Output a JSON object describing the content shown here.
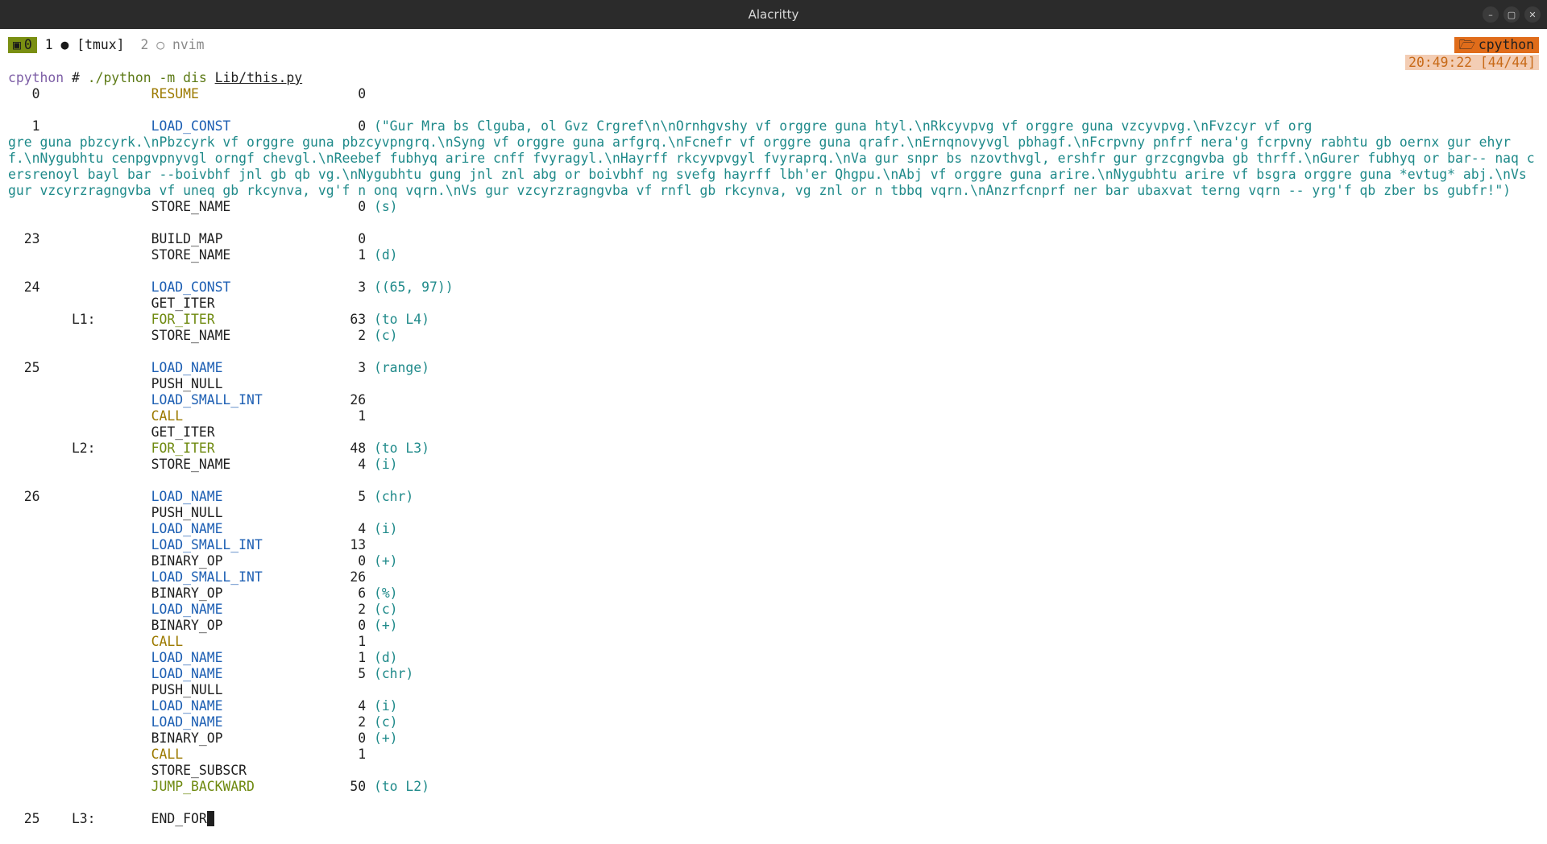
{
  "window": {
    "title": "Alacritty"
  },
  "tmux": {
    "session": "0",
    "windows": [
      {
        "index": "1",
        "flag": "●",
        "name": "[tmux]",
        "active": true
      },
      {
        "index": "2",
        "flag": "○",
        "name": "nvim",
        "active": false
      }
    ],
    "right_label": "cpython",
    "clock": "20:49:22 [44/44]"
  },
  "prompt": {
    "host": "cpython",
    "symbol": "#",
    "cmd": "./python -m dis ",
    "file": "Lib/this.py"
  },
  "disasm": {
    "rows": [
      {
        "ln": "0",
        "label": "",
        "op": "RESUME",
        "oc": "op-yellow",
        "arg": "0",
        "extra": ""
      },
      {
        "blank": true
      },
      {
        "ln": "1",
        "label": "",
        "op": "LOAD_CONST",
        "oc": "op-blue",
        "arg": "0",
        "extra": "(\"Gur Mra bs Clguba, ol Gvz Crgref\\n\\nOrnhgvshy vf orggre guna htyl.\\nRkcyvpvg vf orggre guna vzcyvpvg.\\nFvzcyr vf orggre guna pbzcyrk.\\nPbzcyrk vf orggre guna pbzcyvpngrq.\\nSyng vf orggre guna arfgrq.\\nFcnefr vf orggre guna qrafr.\\nErnqnovyvgl pbhagf.\\nFcrpvny pnfrf nera'g fcrpvny rabhtu gb oernx gur ehyrf.\\nNygubhtu cenpgvpnyvgl orngf chevgl.\\nReebef fubhyq arire cnff fvyragyl.\\nHayrff rkcyvpvgyl fvyraprq.\\nVa gur snpr bs nzovthvgl, ershfr gur grzcgngvba gb thrff.\\nGurer fubhyq or bar-- naq cersrenoyl bayl bar --boivbhf jnl gb qb vg.\\nNygubhtu gung jnl znl abg or boivbhf ng svefg hayrff lbh'er Qhgpu.\\nAbj vf orggre guna arire.\\nNygubhtu arire vf bsgra orggre guna *evtug* abj.\\nVs gur vzcyrzragngvba vf uneq gb rkcynva, vg'f n onq vqrn.\\nVs gur vzcyrzragngvba vf rnfl gb rkcynva, vg znl or n tbbq vqrn.\\nAnzrfcnprf ner bar ubaxvat terng vqrn -- yrg'f qb zber bs gubfr!\")",
        "wrap": true
      },
      {
        "ln": "",
        "label": "",
        "op": "STORE_NAME",
        "oc": "op-plain",
        "arg": "0",
        "extra": "(s)"
      },
      {
        "blank": true
      },
      {
        "ln": "23",
        "label": "",
        "op": "BUILD_MAP",
        "oc": "op-plain",
        "arg": "0",
        "extra": ""
      },
      {
        "ln": "",
        "label": "",
        "op": "STORE_NAME",
        "oc": "op-plain",
        "arg": "1",
        "extra": "(d)"
      },
      {
        "blank": true
      },
      {
        "ln": "24",
        "label": "",
        "op": "LOAD_CONST",
        "oc": "op-blue",
        "arg": "3",
        "extra": "((65, 97))"
      },
      {
        "ln": "",
        "label": "",
        "op": "GET_ITER",
        "oc": "op-plain",
        "arg": "",
        "extra": ""
      },
      {
        "ln": "",
        "label": "L1:",
        "op": "FOR_ITER",
        "oc": "op-green",
        "arg": "63",
        "extra": "(to L4)"
      },
      {
        "ln": "",
        "label": "",
        "op": "STORE_NAME",
        "oc": "op-plain",
        "arg": "2",
        "extra": "(c)"
      },
      {
        "blank": true
      },
      {
        "ln": "25",
        "label": "",
        "op": "LOAD_NAME",
        "oc": "op-blue",
        "arg": "3",
        "extra": "(range)"
      },
      {
        "ln": "",
        "label": "",
        "op": "PUSH_NULL",
        "oc": "op-plain",
        "arg": "",
        "extra": ""
      },
      {
        "ln": "",
        "label": "",
        "op": "LOAD_SMALL_INT",
        "oc": "op-blue",
        "arg": "26",
        "extra": ""
      },
      {
        "ln": "",
        "label": "",
        "op": "CALL",
        "oc": "op-yellow",
        "arg": "1",
        "extra": ""
      },
      {
        "ln": "",
        "label": "",
        "op": "GET_ITER",
        "oc": "op-plain",
        "arg": "",
        "extra": ""
      },
      {
        "ln": "",
        "label": "L2:",
        "op": "FOR_ITER",
        "oc": "op-green",
        "arg": "48",
        "extra": "(to L3)"
      },
      {
        "ln": "",
        "label": "",
        "op": "STORE_NAME",
        "oc": "op-plain",
        "arg": "4",
        "extra": "(i)"
      },
      {
        "blank": true
      },
      {
        "ln": "26",
        "label": "",
        "op": "LOAD_NAME",
        "oc": "op-blue",
        "arg": "5",
        "extra": "(chr)"
      },
      {
        "ln": "",
        "label": "",
        "op": "PUSH_NULL",
        "oc": "op-plain",
        "arg": "",
        "extra": ""
      },
      {
        "ln": "",
        "label": "",
        "op": "LOAD_NAME",
        "oc": "op-blue",
        "arg": "4",
        "extra": "(i)"
      },
      {
        "ln": "",
        "label": "",
        "op": "LOAD_SMALL_INT",
        "oc": "op-blue",
        "arg": "13",
        "extra": ""
      },
      {
        "ln": "",
        "label": "",
        "op": "BINARY_OP",
        "oc": "op-plain",
        "arg": "0",
        "extra": "(+)"
      },
      {
        "ln": "",
        "label": "",
        "op": "LOAD_SMALL_INT",
        "oc": "op-blue",
        "arg": "26",
        "extra": ""
      },
      {
        "ln": "",
        "label": "",
        "op": "BINARY_OP",
        "oc": "op-plain",
        "arg": "6",
        "extra": "(%)"
      },
      {
        "ln": "",
        "label": "",
        "op": "LOAD_NAME",
        "oc": "op-blue",
        "arg": "2",
        "extra": "(c)"
      },
      {
        "ln": "",
        "label": "",
        "op": "BINARY_OP",
        "oc": "op-plain",
        "arg": "0",
        "extra": "(+)"
      },
      {
        "ln": "",
        "label": "",
        "op": "CALL",
        "oc": "op-yellow",
        "arg": "1",
        "extra": ""
      },
      {
        "ln": "",
        "label": "",
        "op": "LOAD_NAME",
        "oc": "op-blue",
        "arg": "1",
        "extra": "(d)"
      },
      {
        "ln": "",
        "label": "",
        "op": "LOAD_NAME",
        "oc": "op-blue",
        "arg": "5",
        "extra": "(chr)"
      },
      {
        "ln": "",
        "label": "",
        "op": "PUSH_NULL",
        "oc": "op-plain",
        "arg": "",
        "extra": ""
      },
      {
        "ln": "",
        "label": "",
        "op": "LOAD_NAME",
        "oc": "op-blue",
        "arg": "4",
        "extra": "(i)"
      },
      {
        "ln": "",
        "label": "",
        "op": "LOAD_NAME",
        "oc": "op-blue",
        "arg": "2",
        "extra": "(c)"
      },
      {
        "ln": "",
        "label": "",
        "op": "BINARY_OP",
        "oc": "op-plain",
        "arg": "0",
        "extra": "(+)"
      },
      {
        "ln": "",
        "label": "",
        "op": "CALL",
        "oc": "op-yellow",
        "arg": "1",
        "extra": ""
      },
      {
        "ln": "",
        "label": "",
        "op": "STORE_SUBSCR",
        "oc": "op-plain",
        "arg": "",
        "extra": ""
      },
      {
        "ln": "",
        "label": "",
        "op": "JUMP_BACKWARD",
        "oc": "op-green",
        "arg": "50",
        "extra": "(to L2)"
      },
      {
        "blank": true
      },
      {
        "ln": "25",
        "label": "L3:",
        "op": "END_FOR",
        "oc": "op-plain",
        "arg": "",
        "extra": "",
        "cursor": true
      }
    ]
  }
}
